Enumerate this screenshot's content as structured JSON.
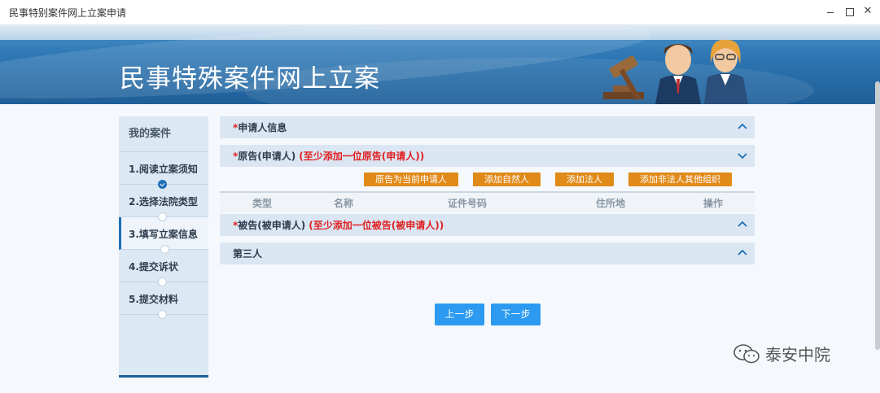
{
  "window": {
    "title": "民事特别案件网上立案申请"
  },
  "banner": {
    "title": "民事特殊案件网上立案"
  },
  "sidebar": {
    "heading": "我的案件",
    "steps": [
      {
        "label": "1.阅读立案须知"
      },
      {
        "label": "2.选择法院类型"
      },
      {
        "label": "3.填写立案信息"
      },
      {
        "label": "4.提交诉状"
      },
      {
        "label": "5.提交材料"
      }
    ],
    "active_step": 3
  },
  "sections": {
    "applicant": {
      "required_mark": "*",
      "title": "申请人信息"
    },
    "plaintiff": {
      "required_mark": "*",
      "title": "原告(申请人)",
      "note": "(至少添加一位原告(申请人))"
    },
    "defendant": {
      "required_mark": "*",
      "title": "被告(被申请人)",
      "note": "(至少添加一位被告(被申请人))"
    },
    "third_party": {
      "title": "第三人"
    }
  },
  "plaintiff_buttons": {
    "as_current": "原告为当前申请人",
    "add_natural": "添加自然人",
    "add_legal": "添加法人",
    "add_other_org": "添加非法人其他组织"
  },
  "table": {
    "headers": {
      "type": "类型",
      "name": "名称",
      "id_no": "证件号码",
      "address": "住所地",
      "action": "操作"
    }
  },
  "nav": {
    "prev": "上一步",
    "next": "下一步"
  },
  "watermark": {
    "text": "泰安中院"
  },
  "colors": {
    "accent": "#2b9af0",
    "orange": "#e08a1a",
    "banner": "#1f5f98",
    "required": "#e02020"
  }
}
